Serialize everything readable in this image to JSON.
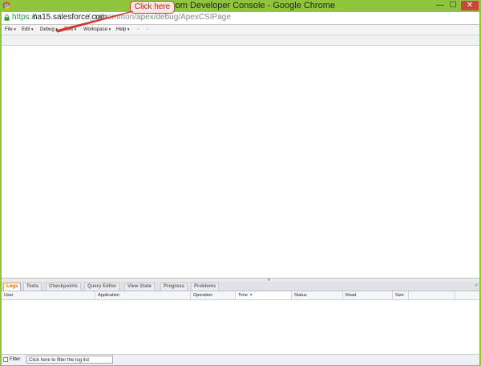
{
  "window": {
    "title": "Force.com Developer Console - Google Chrome",
    "controls": {
      "minimize": "—",
      "maximize": "☐",
      "close": "✕"
    }
  },
  "address": {
    "scheme": "https://",
    "host": "na15.salesforce.com",
    "path": "/_ui/common/apex/debug/ApexCSIPage"
  },
  "menu": {
    "items": [
      "File",
      "Edit",
      "Debug",
      "Test",
      "Workspace",
      "Help"
    ],
    "back": "<",
    "forward": ">"
  },
  "tabs": [
    "Logs",
    "Tests",
    "Checkpoints",
    "Query Editor",
    "View State",
    "Progress",
    "Problems"
  ],
  "active_tab": "Logs",
  "columns": [
    "User",
    "Application",
    "Operation",
    "Time",
    "Status",
    "Read",
    "Size"
  ],
  "sorted_column": "Time",
  "filter": {
    "label": "Filter",
    "placeholder": "Click here to filter the log list"
  },
  "callout": {
    "text": "Click here"
  },
  "colors": {
    "titlebar": "#8fc43c",
    "active_tab": "#d66b00",
    "callout": "#d23a2d"
  }
}
